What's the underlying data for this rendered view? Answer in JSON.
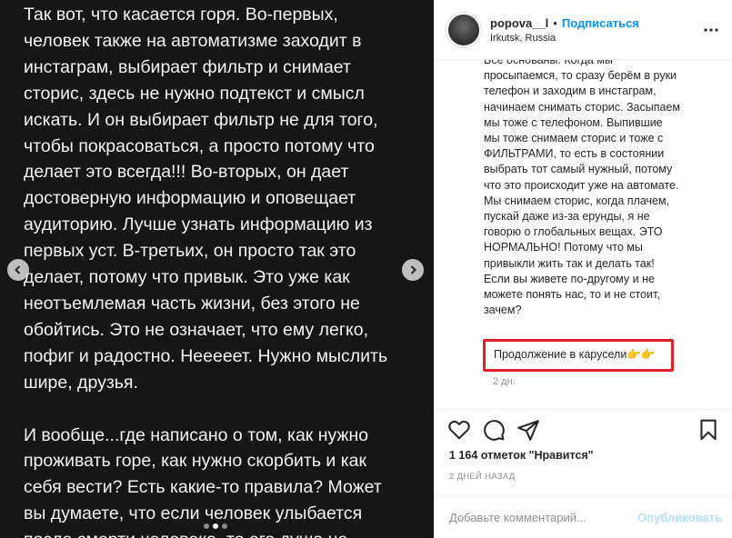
{
  "media": {
    "text": "Так вот, что касается горя. Во-первых,\nчеловек также на автоматизме заходит в\nинстаграм, выбирает фильтр и снимает\nсторис, здесь не нужно подтекст и смысл\nискать. И он выбирает фильтр не для того,\nчтобы покрасоваться, а просто потому что\nделает это всегда!!! Во-вторых, он дает\nдостоверную информацию и оповещает\nаудиторию. Лучше узнать информацию из\nпервых уст. В-третьих, он просто так это\nделает, потому что привык. Это уже как\nнеотъемлемая часть жизни, без этого не\nобойтись. Это не означает, что ему легко,\nпофиг и радостно. Нееееет. Нужно мыслить\nшире, друзья.\n\nИ вообще...где написано о том, как нужно\nпроживать горе, как нужно скорбить и как\nсебя вести? Есть какие-то правила? Может\nвы думаете, что если человек улыбается\nпосле смерти человека, то его душа не"
  },
  "header": {
    "username": "popova__l",
    "separator": "•",
    "follow_label": "Подписаться",
    "location": "Irkutsk, Russia"
  },
  "caption": {
    "text": "Все основаны. Когда мы\nпросыпаемся, то сразу берём в руки\nтелефон и заходим в инстаграм,\nначинаем снимать сторис. Засыпаем\nмы тоже с телефоном. Выпившие\nмы тоже снимаем сторис и тоже с\nФИЛЬТРАМИ, то есть в состоянии\nвыбрать тот самый нужный, потому\nчто это происходит уже на автомате.\nМы снимаем сторис, когда плачем,\nпускай даже из-за ерунды, я не\nговорю о глобальных вещах. ЭТО\nНОРМАЛЬНО! Потому что мы\nпривыкли жить так и делать так!\nЕсли вы живете по-другому и не\nможете понять нас, то и не стоит,\nзачем?",
    "continuation": "Продолжение в карусели👉👉",
    "time": "2 дн."
  },
  "stats": {
    "likes": "1 164 отметок \"Нравится\"",
    "date": "2 ДНЕЙ НАЗАД"
  },
  "comment": {
    "placeholder": "Добавьте комментарий...",
    "post_label": "Опубликовать"
  },
  "carousel": {
    "slide_count": 3,
    "active_index": 1
  },
  "colors": {
    "accent": "#0095f6",
    "highlight": "#e0202a",
    "media_bg": "#161616"
  }
}
